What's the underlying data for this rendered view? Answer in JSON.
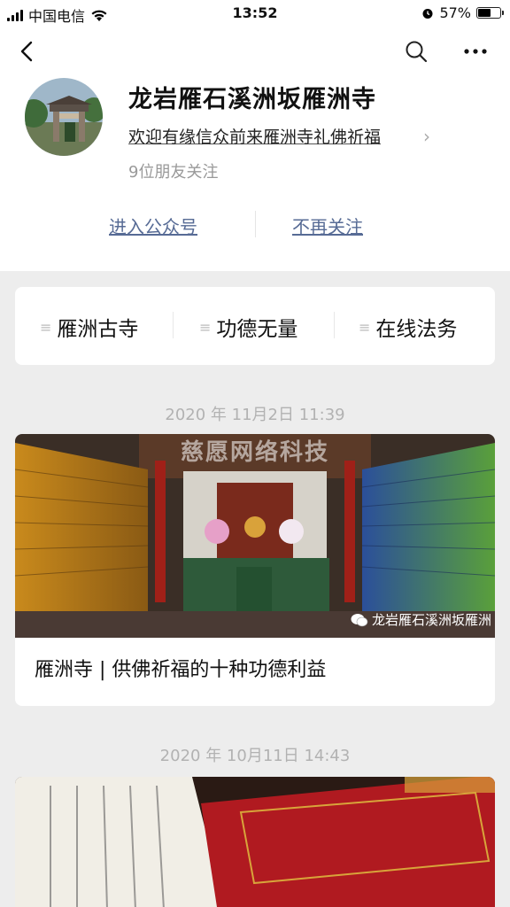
{
  "status_bar": {
    "carrier": "中国电信",
    "time": "13:52",
    "battery": "57%",
    "battery_level": 0.57
  },
  "profile": {
    "name": "龙岩雁石溪洲坂雁洲寺",
    "description": "欢迎有缘信众前来雁洲寺礼佛祈福",
    "friends_following": "9位朋友关注",
    "enter_account": "进入公众号",
    "unfollow": "不再关注"
  },
  "menu": {
    "items": [
      {
        "label": "雁洲古寺"
      },
      {
        "label": "功德无量"
      },
      {
        "label": "在线法务"
      }
    ]
  },
  "feed": [
    {
      "date": "2020 年 11月2日 11:39",
      "title": "雁洲寺 | 供佛祈福的十种功德利益",
      "watermark_top": "慈愿网络科技",
      "watermark_source": "龙岩雁石溪洲坂雁洲"
    },
    {
      "date": "2020 年 10月11日 14:43"
    }
  ],
  "icons": {
    "back": "chevron-left-icon",
    "search": "search-icon",
    "more": "more-dots-icon",
    "wifi": "wifi-icon",
    "alarm": "alarm-icon",
    "menu": "hamburger-icon"
  },
  "colors": {
    "link": "#576b95",
    "background": "#ededed",
    "muted_text": "#999999"
  }
}
